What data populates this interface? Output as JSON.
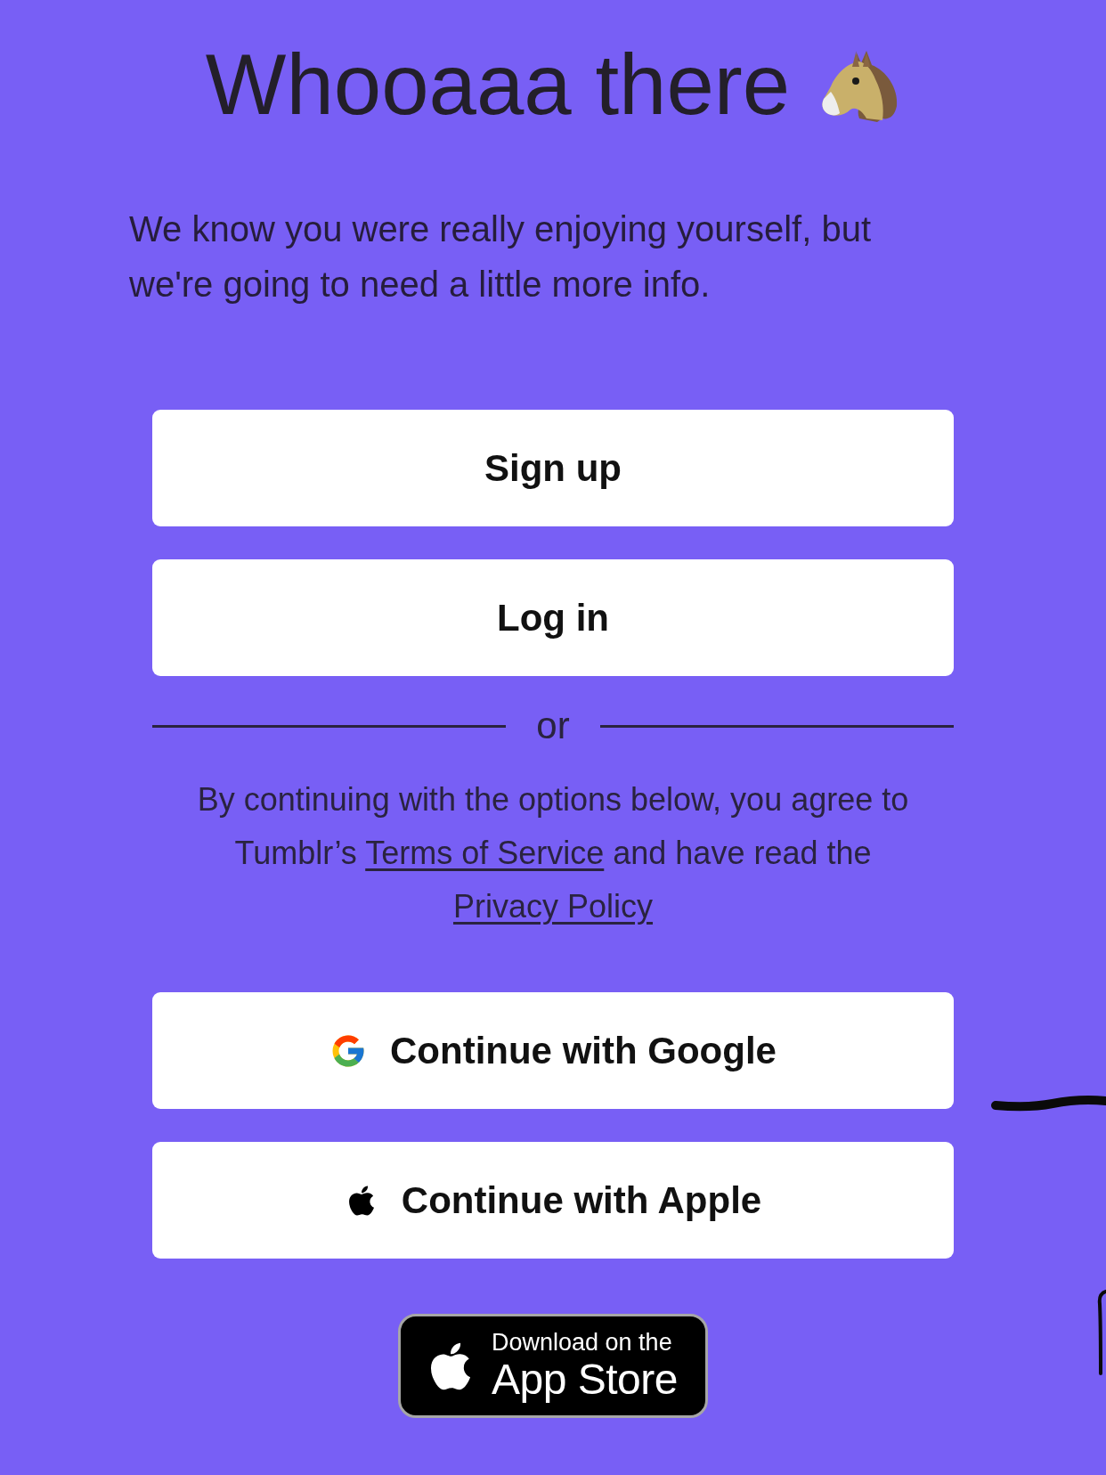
{
  "title": "Whooaaa there",
  "intro": "We know you were really enjoying yourself, but we're going to need a little more info.",
  "buttons": [
    "Sign up",
    "Log in"
  ],
  "divider": "or",
  "legal": [
    {
      "kind": "text",
      "text": "By continuing with the options below, you agree to Tumblr’s "
    },
    {
      "kind": "link",
      "text": "Terms of Service"
    },
    {
      "kind": "text",
      "text": " and have read the "
    },
    {
      "kind": "link",
      "text": "Privacy Policy"
    }
  ],
  "social_buttons": [
    {
      "kind": "google",
      "label": "Continue with Google"
    },
    {
      "kind": "apple",
      "label": "Continue with Apple"
    }
  ],
  "app_store_badge": {
    "caption": "Download on the",
    "name": "App Store"
  }
}
